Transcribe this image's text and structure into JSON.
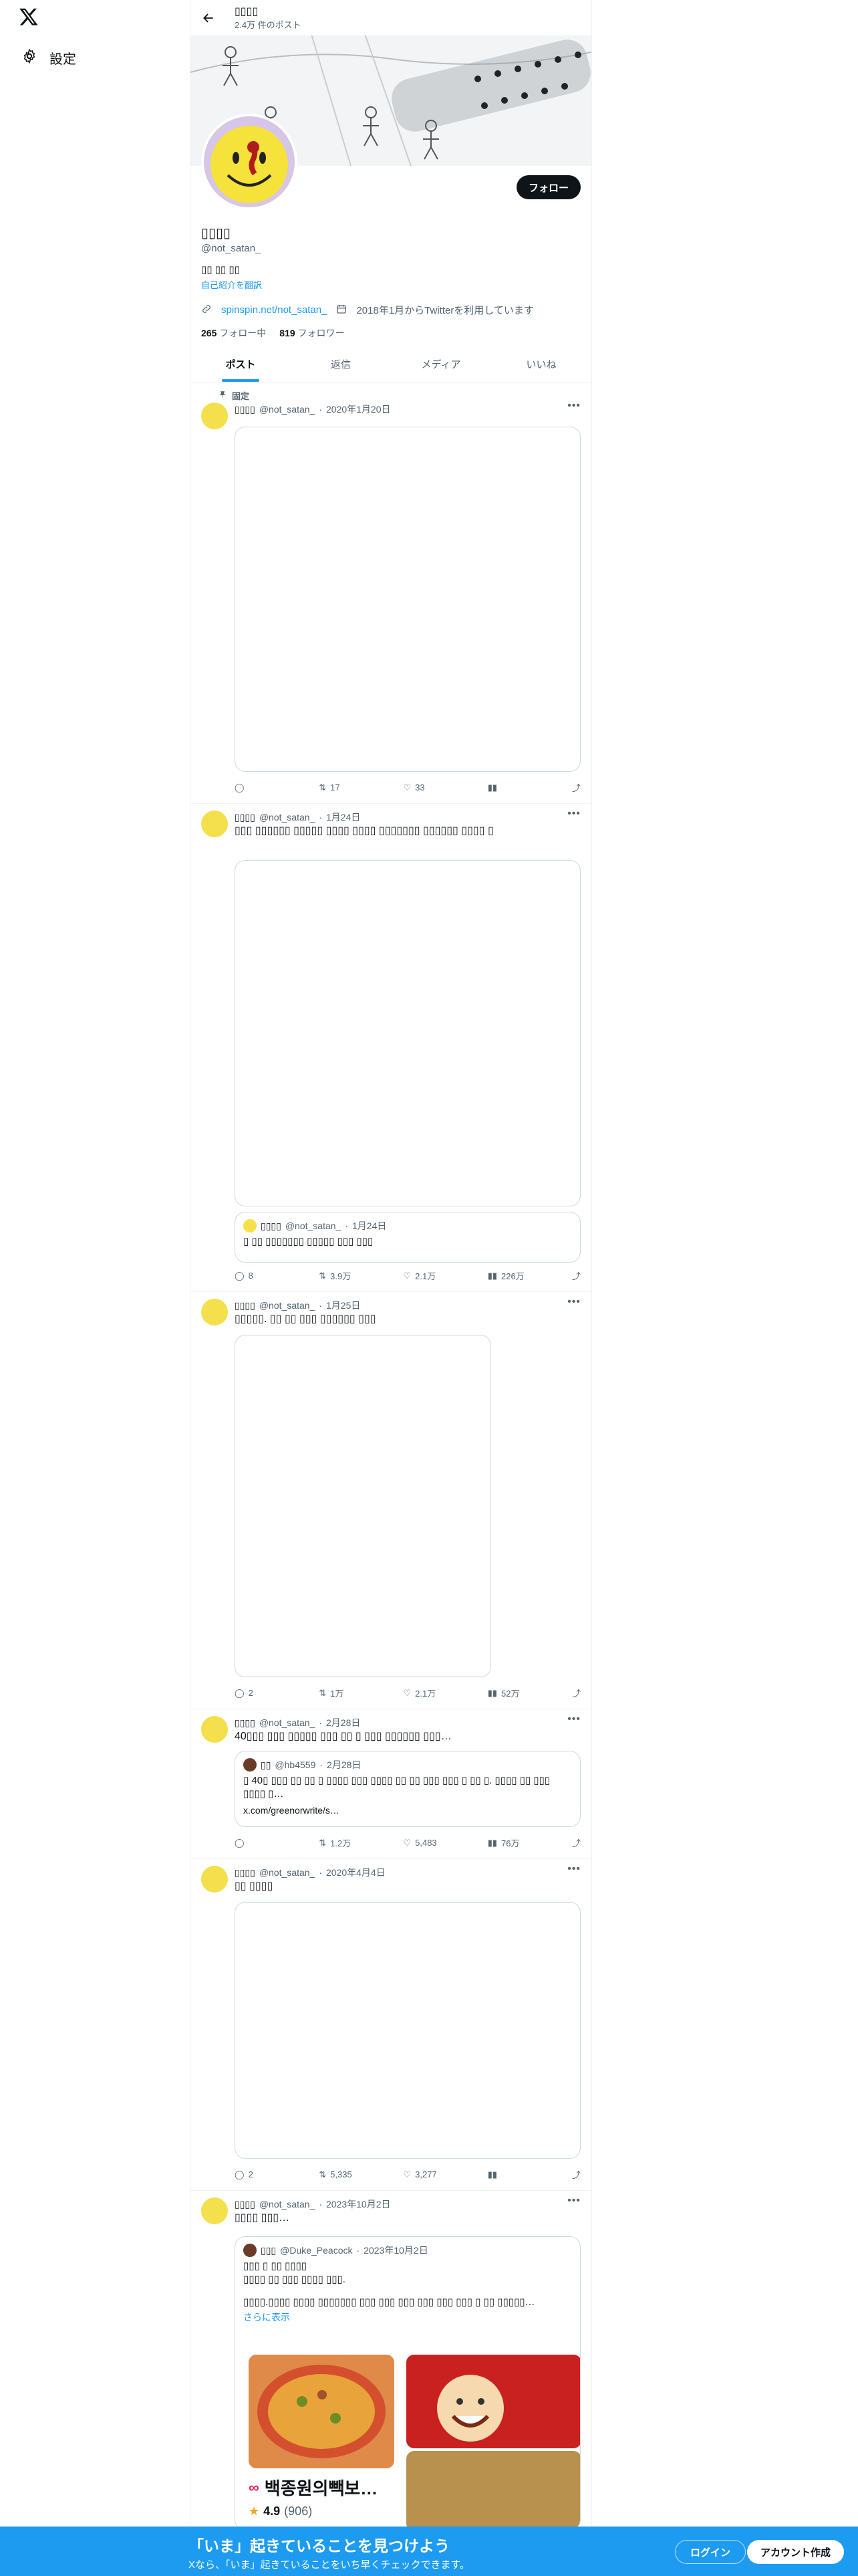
{
  "nav": {
    "settings_label": "設定"
  },
  "header": {
    "name": "▯▯▯▯",
    "post_count": "2.4万 件のポスト"
  },
  "profile": {
    "name": "▯▯▯▯",
    "handle": "@not_satan_",
    "bio": "▯▯ ▯▯ ▯▯",
    "translate": "自己紹介を翻訳",
    "link": "spinspin.net/not_satan_",
    "joined": "2018年1月からTwitterを利用しています",
    "following_count": "265",
    "following_label": "フォロー中",
    "followers_count": "819",
    "followers_label": "フォロワー",
    "follow_button": "フォロー"
  },
  "tabs": [
    "ポスト",
    "返信",
    "メディア",
    "いいね"
  ],
  "pinned_label": "固定",
  "posts": [
    {
      "name": "▯▯▯▯",
      "handle": "@not_satan_",
      "date": "2020年1月20日",
      "text": "",
      "reply": "",
      "repost": "17",
      "like": "33",
      "views": ""
    },
    {
      "name": "▯▯▯▯",
      "handle": "@not_satan_",
      "date": "1月24日",
      "text": "▯▯▯ ▯▯▯▯▯▯ ▯▯▯▯▯ ▯▯▯▯ ▯▯▯▯ ▯▯▯▯▯▯▯ ▯▯▯▯▯▯ ▯▯▯▯ ▯",
      "quote": {
        "name": "▯▯▯▯",
        "handle": "@not_satan_",
        "date": "1月24日",
        "text": "▯ ▯▯ ▯▯▯▯▯▯▯ ▯▯▯▯▯ ▯▯▯ ▯▯▯"
      },
      "reply": "8",
      "repost": "3.9万",
      "like": "2.1万",
      "views": "226万"
    },
    {
      "name": "▯▯▯▯",
      "handle": "@not_satan_",
      "date": "1月25日",
      "text": "▯▯▯▯▯. ▯▯ ▯▯ ▯▯▯ ▯▯▯▯▯▯ ▯▯▯",
      "reply": "2",
      "repost": "1万",
      "like": "2.1万",
      "views": "52万"
    },
    {
      "name": "▯▯▯▯",
      "handle": "@not_satan_",
      "date": "2月28日",
      "text": "40▯▯▯ ▯▯▯ ▯▯▯▯▯ ▯▯▯ ▯▯ ▯ ▯▯▯ ▯▯▯▯▯▯ ▯▯▯…",
      "quote": {
        "name": "▯▯",
        "handle": "@hb4559",
        "date": "2月28日",
        "text": "▯ 40▯ ▯▯▯ ▯▯ ▯▯ ▯ ▯▯▯▯ ▯▯▯ ▯▯▯▯ ▯▯ ▯▯ ▯▯▯ ▯▯▯ ▯ ▯▯ ▯. ▯▯▯▯ ▯▯ ▯▯▯ ▯▯▯▯ ▯…",
        "url": "x.com/greenorwrite/s…"
      },
      "reply": "",
      "repost": "1.2万",
      "like": "5,483",
      "views": "76万"
    },
    {
      "name": "▯▯▯▯",
      "handle": "@not_satan_",
      "date": "2020年4月4日",
      "text": "▯▯ ▯▯▯▯",
      "reply": "2",
      "repost": "5,335",
      "like": "3,277",
      "views": ""
    },
    {
      "name": "▯▯▯▯",
      "handle": "@not_satan_",
      "date": "2023年10月2日",
      "text": "▯▯▯▯ ▯▯▯…",
      "quote": {
        "name": "▯▯▯",
        "handle": "@Duke_Peacock",
        "date": "2023年10月2日",
        "line1": "▯▯▯ ▯ ▯▯ ▯▯▯▯",
        "line2": "▯▯▯▯ ▯▯ ▯▯▯ ▯▯▯▯ ▯▯▯.",
        "line3": "▯▯▯▯.▯▯▯▯ ▯▯▯▯ ▯▯▯▯▯▯▯ ▯▯▯ ▯▯▯ ▯▯▯ ▯▯▯ ▯▯▯ ▯▯▯ ▯ ▯▯ ▯▯▯▯▯…",
        "show_more": "さらに表示",
        "card_title": "백종원의빽보…",
        "rating": "4.9",
        "rating_count": "(906)"
      }
    }
  ],
  "bottom": {
    "title": "「いま」起きていることを見つけよう",
    "subtitle": "Xなら、「いま」起きていることをいち早くチェックできます。",
    "login": "ログイン",
    "signup": "アカウント作成"
  },
  "colors": {
    "accent": "#1d9bf0",
    "text": "#0f1419",
    "muted": "#536471"
  },
  "icons": [
    "x-logo-icon",
    "gear-icon",
    "back-arrow-icon",
    "link-icon",
    "calendar-icon",
    "pin-icon",
    "reply-icon",
    "repost-icon",
    "like-icon",
    "views-icon",
    "share-icon",
    "more-icon",
    "star-icon"
  ]
}
